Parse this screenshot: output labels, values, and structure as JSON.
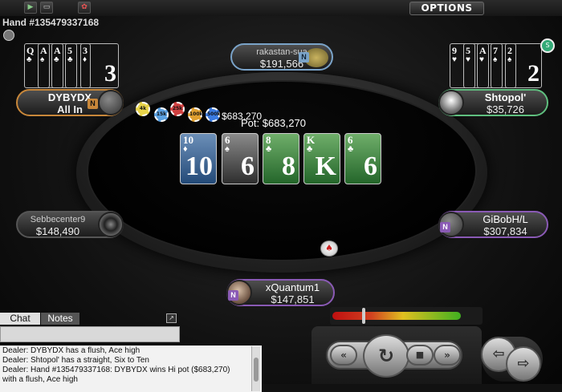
{
  "toolbar": {
    "options_label": "OPTIONS"
  },
  "hand": {
    "title": "Hand #135479337168"
  },
  "seats": [
    {
      "name": "rakastan-sua",
      "stack": "$191,566",
      "badge": "N"
    },
    {
      "name": "DYBYDX",
      "stack": "All In",
      "badge": "N"
    },
    {
      "name": "Shtopol'",
      "stack": "$35,726"
    },
    {
      "name": "Sebbecenter9",
      "stack": "$148,490"
    },
    {
      "name": "GiBobH/L",
      "stack": "$307,834",
      "badge": "N"
    },
    {
      "name": "xQuantum1",
      "stack": "$147,851",
      "badge": "N"
    }
  ],
  "pot": {
    "label": "Pot: $683,270",
    "chips_amount": "$683,270",
    "chips": [
      "4k",
      "15k",
      "25k",
      "100k",
      "500k"
    ]
  },
  "board": [
    {
      "rank": "10",
      "suit": "♦",
      "color": "blue"
    },
    {
      "rank": "6",
      "suit": "♠",
      "color": "gray"
    },
    {
      "rank": "8",
      "suit": "♣",
      "color": "green"
    },
    {
      "rank": "K",
      "suit": "♣",
      "color": "green"
    },
    {
      "rank": "6",
      "suit": "♣",
      "color": "green"
    }
  ],
  "hero_left_cards": [
    {
      "rank": "Q",
      "suit": "♣",
      "color": "green"
    },
    {
      "rank": "A",
      "suit": "♠",
      "color": "gray"
    },
    {
      "rank": "A",
      "suit": "♣",
      "color": "green"
    },
    {
      "rank": "5",
      "suit": "♣",
      "color": "green"
    },
    {
      "rank": "3",
      "suit": "♦",
      "color": "blue",
      "big": "3"
    }
  ],
  "hero_right_cards": [
    {
      "rank": "9",
      "suit": "♥",
      "color": "red"
    },
    {
      "rank": "5",
      "suit": "♥",
      "color": "red"
    },
    {
      "rank": "A",
      "suit": "♥",
      "color": "red"
    },
    {
      "rank": "7",
      "suit": "♠",
      "color": "gray"
    },
    {
      "rank": "2",
      "suit": "♠",
      "color": "gray",
      "big": "2"
    }
  ],
  "chat": {
    "tab_chat": "Chat",
    "tab_notes": "Notes",
    "input_value": "",
    "lines": [
      "Dealer: DYBYDX has a flush, Ace high",
      "Dealer: Shtopol' has a straight, Six to Ten",
      "Dealer: Hand #135479337168: DYBYDX wins Hi pot ($683,270)",
      "with a flush, Ace high"
    ]
  },
  "dealer_button": {
    "symbol": "♠"
  },
  "colors": {
    "seat_orange": "#c8873a",
    "seat_green": "#5fbf7f",
    "seat_blue": "#7aa3c8",
    "seat_purple": "#8a5ab5"
  },
  "icons": [
    "play-icon",
    "window-icon",
    "color-wheel-icon",
    "chip-stack-icon",
    "rewind-icon",
    "replay-icon",
    "stop-icon",
    "back-icon",
    "forward-icon",
    "popout-icon",
    "dealer-button-icon"
  ]
}
